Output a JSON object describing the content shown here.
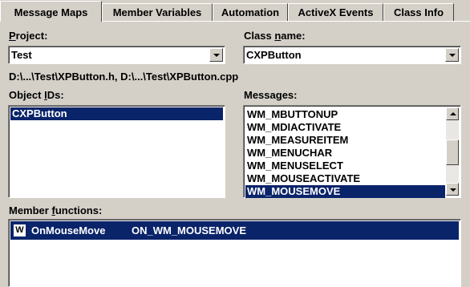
{
  "tabs": [
    {
      "label": "Message Maps",
      "active": true
    },
    {
      "label": "Member Variables",
      "active": false
    },
    {
      "label": "Automation",
      "active": false
    },
    {
      "label": "ActiveX Events",
      "active": false
    },
    {
      "label": "Class Info",
      "active": false
    }
  ],
  "project": {
    "label_u": "P",
    "label_rest": "roject:",
    "value": "Test"
  },
  "class_name": {
    "label_pre": "Class ",
    "label_u": "n",
    "label_rest": "ame:",
    "value": "CXPButton"
  },
  "file_path": "D:\\...\\Test\\XPButton.h, D:\\...\\Test\\XPButton.cpp",
  "object_ids": {
    "label_pre": "Object ",
    "label_u": "I",
    "label_rest": "Ds:",
    "items": [
      "CXPButton"
    ],
    "selected": "CXPButton"
  },
  "messages": {
    "label_pre": "Messa",
    "label_u": "g",
    "label_rest": "es:",
    "items": [
      "WM_MBUTTONUP",
      "WM_MDIACTIVATE",
      "WM_MEASUREITEM",
      "WM_MENUCHAR",
      "WM_MENUSELECT",
      "WM_MOUSEACTIVATE",
      "WM_MOUSEMOVE"
    ],
    "selected": "WM_MOUSEMOVE"
  },
  "member_functions": {
    "label_pre": "Member ",
    "label_u": "f",
    "label_rest": "unctions:",
    "icon": "W",
    "rows": [
      {
        "name": "OnMouseMove",
        "macro": "ON_WM_MOUSEMOVE",
        "selected": true
      }
    ]
  },
  "icons": {
    "combo": "chevron-down-icon",
    "scroll_up": "scroll-up-arrow-icon",
    "scroll_down": "scroll-down-arrow-icon",
    "handler": "windows-message-icon"
  },
  "colors": {
    "face": "#d4d0c8",
    "selection": "#0a246a",
    "field": "#ffffff"
  }
}
